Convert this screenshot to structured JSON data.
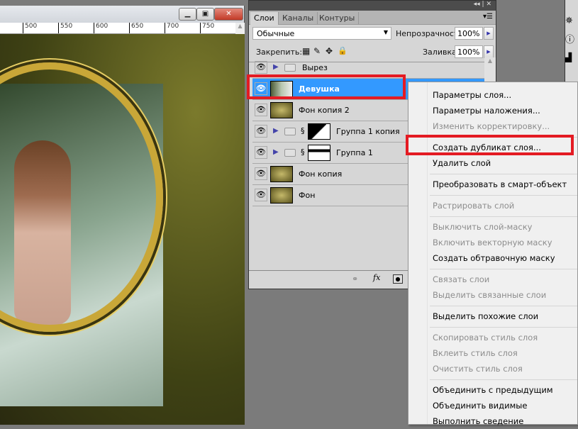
{
  "document": {
    "ruler_ticks": [
      "500",
      "550",
      "600",
      "650",
      "700",
      "750"
    ]
  },
  "panel": {
    "tabs": [
      "Слои",
      "Каналы",
      "Контуры"
    ],
    "blend_mode": "Обычные",
    "opacity_label": "Непрозрачность:",
    "opacity": "100%",
    "lock_label": "Закрепить:",
    "fill_label": "Заливка:",
    "fill": "100%",
    "layers": [
      {
        "name": "Вырез",
        "type": "group"
      },
      {
        "name": "Девушка",
        "type": "image",
        "selected": true
      },
      {
        "name": "Фон копия 2",
        "type": "image"
      },
      {
        "name": "Группа 1 копия",
        "type": "group-mask"
      },
      {
        "name": "Группа 1",
        "type": "group-mask"
      },
      {
        "name": "Фон копия",
        "type": "image"
      },
      {
        "name": "Фон",
        "type": "image"
      }
    ]
  },
  "context_menu": {
    "items": [
      {
        "label": "Параметры слоя...",
        "enabled": true
      },
      {
        "label": "Параметры наложения...",
        "enabled": true
      },
      {
        "label": "Изменить корректировку...",
        "enabled": false
      },
      {
        "label": "Создать дубликат слоя...",
        "enabled": true,
        "highlighted": true
      },
      {
        "label": "Удалить слой",
        "enabled": true
      },
      {
        "label": "Преобразовать в смарт-объект",
        "enabled": true
      },
      {
        "label": "Растрировать слой",
        "enabled": false
      },
      {
        "label": "Выключить слой-маску",
        "enabled": false
      },
      {
        "label": "Включить векторную маску",
        "enabled": false
      },
      {
        "label": "Создать обтравочную маску",
        "enabled": true
      },
      {
        "label": "Связать слои",
        "enabled": false
      },
      {
        "label": "Выделить связанные слои",
        "enabled": false
      },
      {
        "label": "Выделить похожие слои",
        "enabled": true
      },
      {
        "label": "Скопировать стиль слоя",
        "enabled": false
      },
      {
        "label": "Вклеить стиль слоя",
        "enabled": false
      },
      {
        "label": "Очистить стиль слоя",
        "enabled": false
      },
      {
        "label": "Объединить с предыдущим",
        "enabled": true
      },
      {
        "label": "Объединить видимые",
        "enabled": true
      },
      {
        "label": "Выполнить сведение",
        "enabled": true
      }
    ]
  },
  "colors": {
    "highlight_box": "#e41b23",
    "selection": "#3399ff"
  }
}
